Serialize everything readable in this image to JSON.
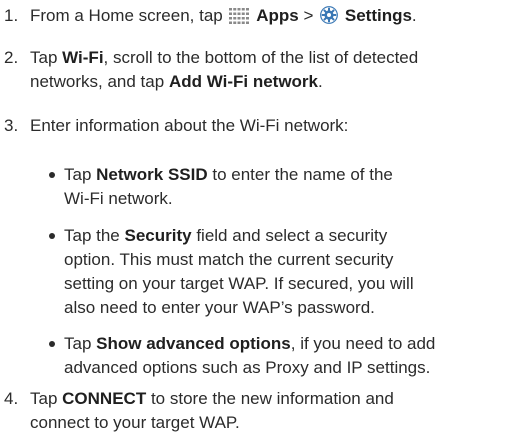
{
  "steps": [
    {
      "number": "1.",
      "text_a": "From a Home screen, tap",
      "apps_icon": "apps-grid-icon",
      "bold_apps": "Apps",
      "sep": ">",
      "settings_icon": "settings-gear-icon",
      "bold_settings": "Settings",
      "end": "."
    },
    {
      "number": "2.",
      "text_a": "Tap",
      "bold_wifi": "Wi-Fi",
      "text_b": ", scroll to the bottom of the list of detected",
      "text_c": "networks, and tap",
      "bold_add": "Add Wi-Fi network",
      "end": "."
    },
    {
      "number": "3.",
      "text": "Enter information about the Wi-Fi network:",
      "bullets": [
        {
          "pre": "Tap",
          "bold": "Network SSID",
          "rest_1": "to enter the name of the",
          "rest_2": "Wi-Fi network."
        },
        {
          "pre": "Tap the",
          "bold": "Security",
          "rest_1": "field and select a security",
          "rest_2": "option. This must match the current security",
          "rest_3": "setting on your target WAP. If secured, you will",
          "rest_4": "also need to enter your WAP’s password."
        },
        {
          "pre": "Tap",
          "bold": "Show advanced options",
          "rest_1": ", if you need to add",
          "rest_2": "advanced options such as Proxy and IP settings."
        }
      ]
    },
    {
      "number": "4.",
      "text_a": "Tap",
      "bold_connect": "CONNECT",
      "text_b": "to store the new information and",
      "text_c": "connect to your target WAP."
    }
  ],
  "colors": {
    "text": "#2b2b2b",
    "icon_apps": "#8a8a8a",
    "icon_settings": "#3a78b5"
  }
}
